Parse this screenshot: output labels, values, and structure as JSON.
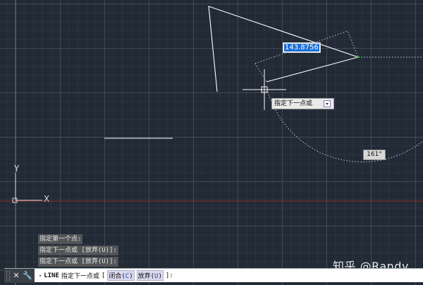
{
  "dynamic_input": {
    "value": "143.8756"
  },
  "prompt_tooltip": {
    "text": "指定下一点或",
    "arrow_icon": "dropdown-arrow-icon"
  },
  "angle_readout": {
    "value": "161°"
  },
  "command_history": [
    "指定第一个点:",
    "指定下一点或 [放弃(U)]:",
    "指定下一点或 [放弃(U)]:"
  ],
  "command_line": {
    "command": "LINE",
    "prompt": "指定下一点或",
    "bracket_open": "[",
    "option1_label": "闭合(",
    "option1_key": "C",
    "option1_close": ")",
    "option2_label": "放弃(",
    "option2_key": "U",
    "option2_close": ")",
    "bracket_close": "]:",
    "tools": {
      "close": "✕",
      "customize": "🔧",
      "recent": "▾"
    }
  },
  "ucs": {
    "x_label": "X",
    "y_label": "Y"
  },
  "watermark": "知乎 @Randy",
  "colors": {
    "background": "#222a36",
    "geometry": "#ffffff",
    "y_axis": "#3a8f3a",
    "x_axis": "#8f2a2a",
    "selection": "#1a6fd6",
    "endpoint_marker": "#3bd13b"
  }
}
